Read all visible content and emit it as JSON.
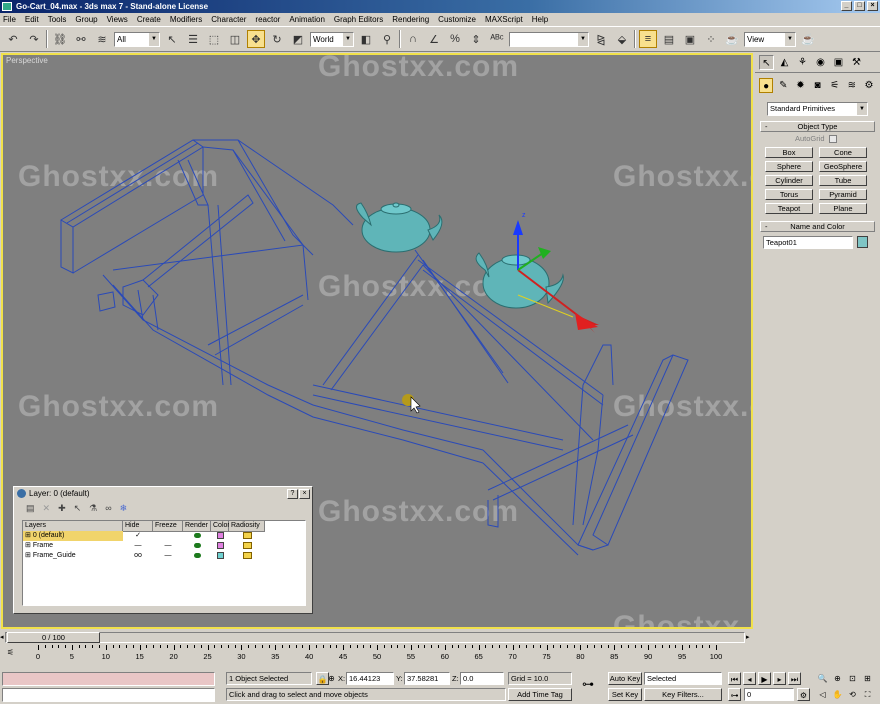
{
  "window": {
    "title": "Go-Cart_04.max - 3ds max 7 - Stand-alone License",
    "controls": [
      "_",
      "□",
      "×"
    ]
  },
  "menu": [
    "File",
    "Edit",
    "Tools",
    "Group",
    "Views",
    "Create",
    "Modifiers",
    "Character",
    "reactor",
    "Animation",
    "Graph Editors",
    "Rendering",
    "Customize",
    "MAXScript",
    "Help"
  ],
  "toolbar": {
    "selection_filter": "All",
    "reference_coord": "World",
    "named_selection": "",
    "render_type": "View"
  },
  "viewport": {
    "label": "Perspective",
    "watermark": "Ghostxx.com"
  },
  "command_panel": {
    "category": "Standard Primitives",
    "object_type_title": "Object Type",
    "autogrid_label": "AutoGrid",
    "autogrid_checked": false,
    "object_buttons": [
      "Box",
      "Cone",
      "Sphere",
      "GeoSphere",
      "Cylinder",
      "Tube",
      "Torus",
      "Pyramid",
      "Teapot",
      "Plane"
    ],
    "name_color_title": "Name and Color",
    "object_name": "Teapot01",
    "object_color": "#7fc5c5"
  },
  "layer_dialog": {
    "title": "Layer: 0 (default)",
    "help_label": "?",
    "close_label": "×",
    "columns": [
      "Layers",
      "Hide",
      "Freeze",
      "Render",
      "Color",
      "Radiosity"
    ],
    "rows": [
      {
        "name": "0 (default)",
        "hide": "✓",
        "freeze": "",
        "color": "#e080e0",
        "selected": true
      },
      {
        "name": "Frame",
        "hide": "—",
        "freeze": "—",
        "color": "#e080e0",
        "selected": false
      },
      {
        "name": "Frame_Guide",
        "hide": "oo",
        "freeze": "—",
        "color": "#6fd0d0",
        "selected": false
      }
    ]
  },
  "timeline": {
    "frame_label": "0 / 100",
    "ticks": [
      "0",
      "5",
      "10",
      "15",
      "20",
      "25",
      "30",
      "35",
      "40",
      "45",
      "50",
      "55",
      "60",
      "65",
      "70",
      "75",
      "80",
      "85",
      "90",
      "95",
      "100"
    ]
  },
  "status": {
    "selection": "1 Object Selected",
    "prompt": "Click and drag to select and move objects",
    "x_label": "X:",
    "x_value": "16.44123",
    "y_label": "Y:",
    "y_value": "37.58281",
    "z_label": "Z:",
    "z_value": "0.0",
    "grid": "Grid = 10.0",
    "add_time_tag": "Add Time Tag",
    "auto_key": "Auto Key",
    "set_key": "Set Key",
    "key_mode": "Selected",
    "key_filters": "Key Filters...",
    "current_frame": "0"
  }
}
